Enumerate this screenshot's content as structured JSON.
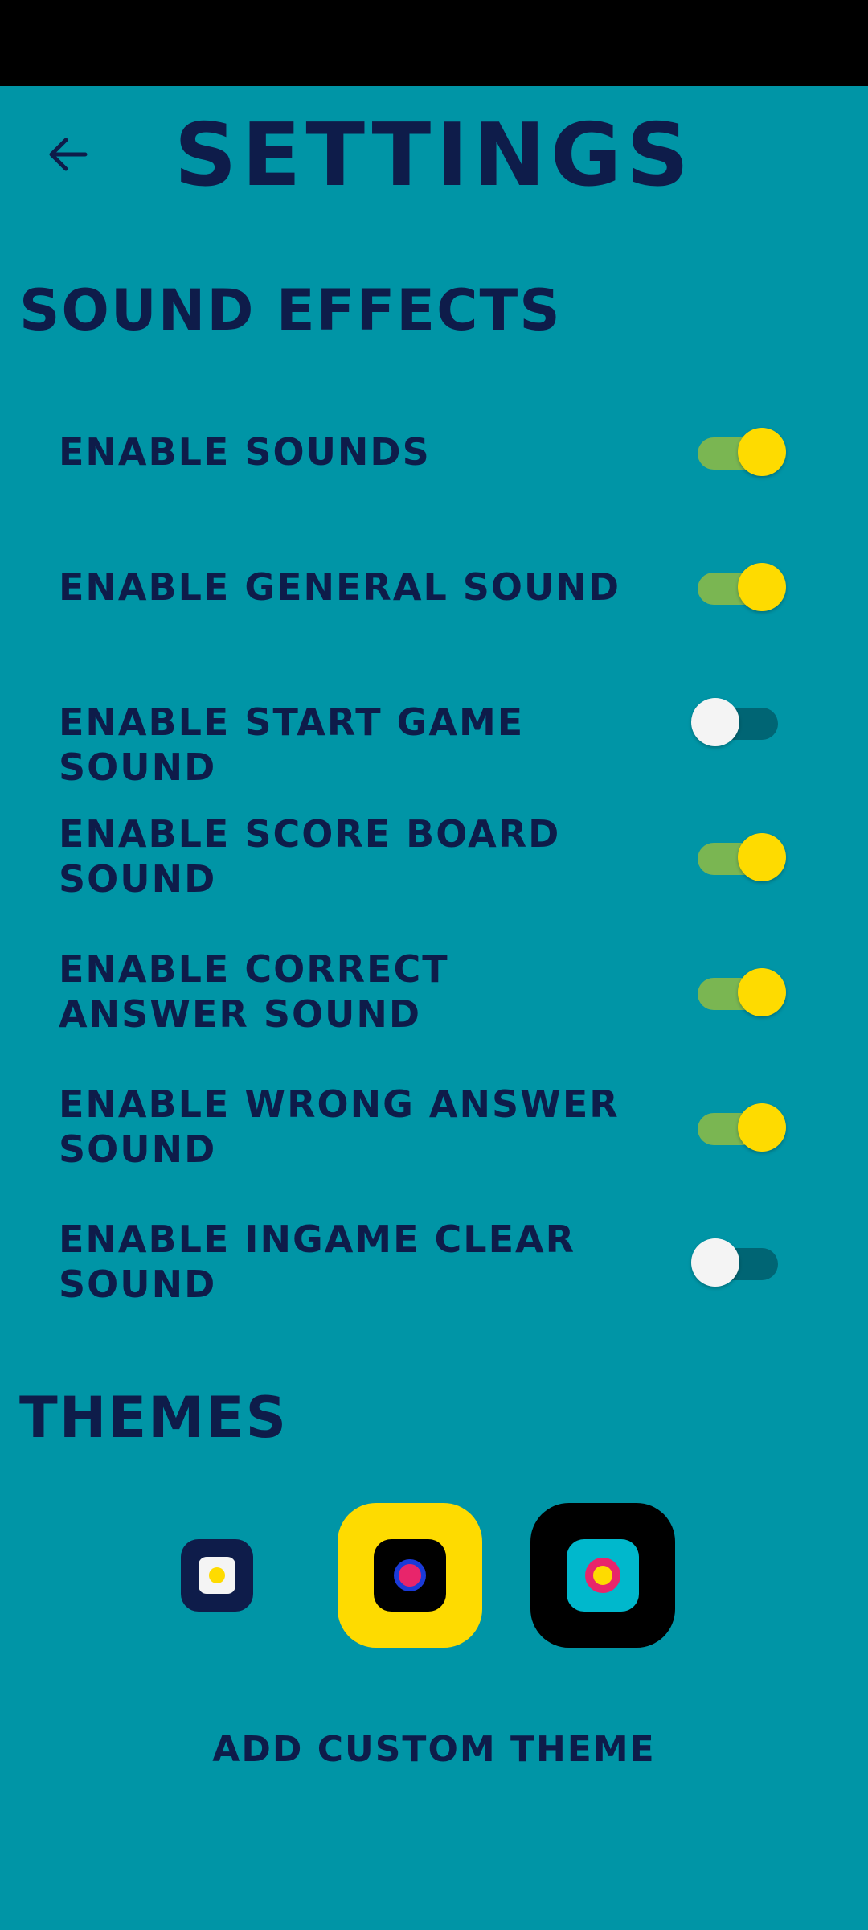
{
  "header": {
    "title": "SETTINGS",
    "back_icon": "arrow-left-icon"
  },
  "sound_effects": {
    "title": "SOUND EFFECTS",
    "items": [
      {
        "label": "Enable sounds",
        "enabled": true
      },
      {
        "label": "Enable general sound",
        "enabled": true
      },
      {
        "label": "Enable start game sound",
        "enabled": false
      },
      {
        "label": "Enable score board sound",
        "enabled": true
      },
      {
        "label": "Enable correct answer sound",
        "enabled": true
      },
      {
        "label": "Enable wrong answer sound",
        "enabled": true
      },
      {
        "label": "Enable ingame clear sound",
        "enabled": false
      }
    ]
  },
  "themes": {
    "title": "THEMES",
    "options": [
      {
        "outer": "#0e1c4a",
        "inner": "#f4f4f4",
        "dot": "#fedb00",
        "selected": false
      },
      {
        "outer": "#fedb00",
        "inner": "#000000",
        "dot": "#e8256b",
        "ring": "#1a3ad8",
        "selected": true
      },
      {
        "outer": "#000000",
        "inner": "#00b8cc",
        "dot": "#fedb00",
        "ring": "#e8256b",
        "selected": true
      }
    ],
    "add_custom_label": "ADD CUSTOM THEME"
  },
  "colors": {
    "background": "#0095a6",
    "text": "#0e1c4a",
    "toggle_on_thumb": "#fedb00",
    "toggle_on_track": "#7ab652",
    "toggle_off_thumb": "#f4f4f4",
    "toggle_off_track": "#006574"
  }
}
